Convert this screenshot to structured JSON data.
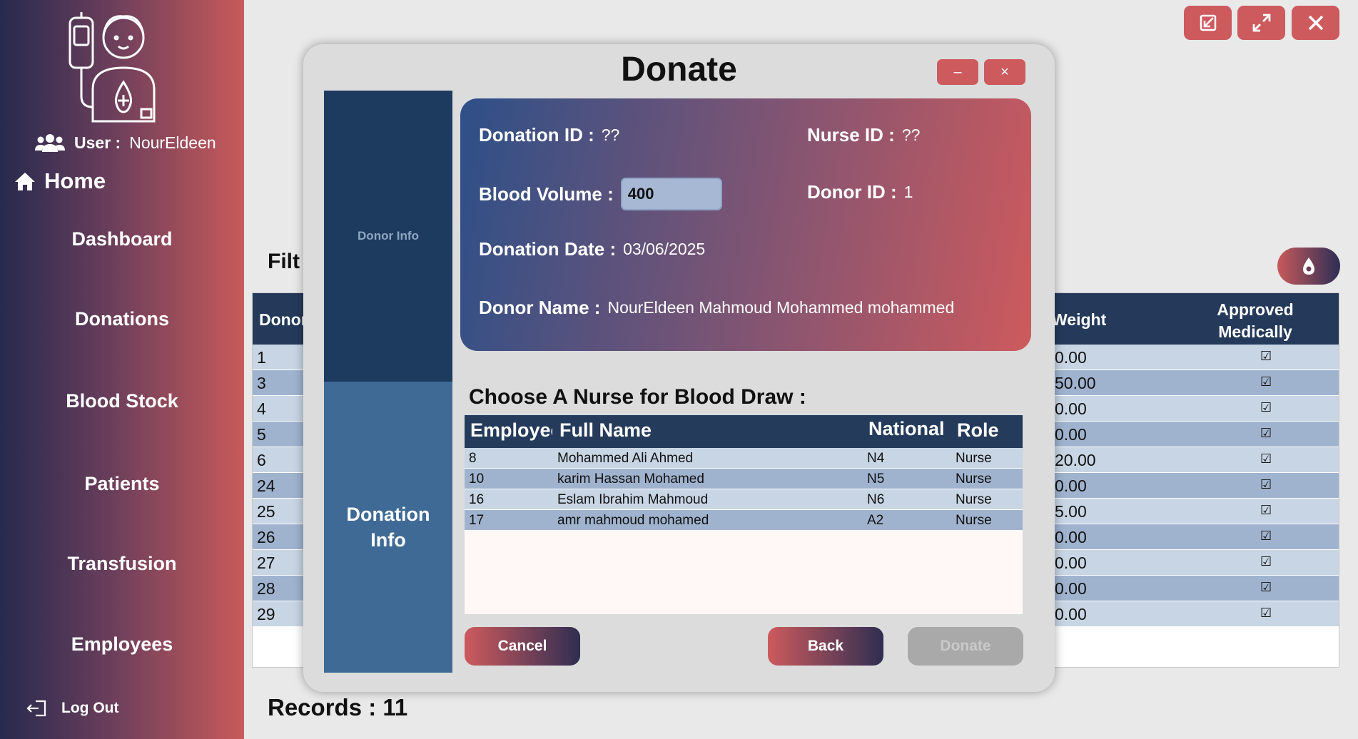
{
  "sidebar": {
    "user_label": "User :",
    "user_name": "NourEldeen",
    "home_label": "Home",
    "nav": [
      "Dashboard",
      "Donations",
      "Blood Stock",
      "Patients",
      "Transfusion",
      "Employees"
    ],
    "logout_label": "Log Out"
  },
  "colors": {
    "accent_red": "#cd5a5d",
    "navy": "#253a5a",
    "sidebar_dark": "#262a4e"
  },
  "background": {
    "filter_label": "Filt",
    "table": {
      "headers": [
        "Donor",
        "Weight",
        "Approved Medically"
      ],
      "rows": [
        {
          "id": "1",
          "weight": "0.00",
          "approved": "☑"
        },
        {
          "id": "3",
          "weight": "50.00",
          "approved": "☑"
        },
        {
          "id": "4",
          "weight": "0.00",
          "approved": "☑"
        },
        {
          "id": "5",
          "weight": "0.00",
          "approved": "☑"
        },
        {
          "id": "6",
          "weight": "20.00",
          "approved": "☑"
        },
        {
          "id": "24",
          "weight": "0.00",
          "approved": "☑"
        },
        {
          "id": "25",
          "weight": "5.00",
          "approved": "☑"
        },
        {
          "id": "26",
          "weight": "0.00",
          "approved": "☑"
        },
        {
          "id": "27",
          "weight": "0.00",
          "approved": "☑"
        },
        {
          "id": "28",
          "weight": "0.00",
          "approved": "☑"
        },
        {
          "id": "29",
          "weight": "0.00",
          "approved": "☑"
        }
      ]
    },
    "records_label": "Records : 11"
  },
  "modal": {
    "title": "Donate",
    "minimize_label": "–",
    "close_label": "×",
    "tabs": {
      "donor": "Donor Info",
      "donation": "Donation Info"
    },
    "fields": {
      "donation_id_label": "Donation ID :",
      "donation_id_value": "??",
      "nurse_id_label": "Nurse ID :",
      "nurse_id_value": "??",
      "blood_volume_label": "Blood Volume :",
      "blood_volume_value": "400",
      "donor_id_label": "Donor ID :",
      "donor_id_value": "1",
      "donation_date_label": "Donation Date :",
      "donation_date_value": "03/06/2025",
      "donor_name_label": "Donor Name :",
      "donor_name_value": "NourEldeen Mahmoud Mohammed mohammed"
    },
    "choose_label": "Choose A Nurse for Blood Draw  :",
    "nurse_table": {
      "headers": [
        "Employee",
        "Full Name",
        "National",
        "Role"
      ],
      "rows": [
        {
          "id": "8",
          "name": "Mohammed Ali Ahmed",
          "national": "N4",
          "role": "Nurse"
        },
        {
          "id": "10",
          "name": "karim Hassan Mohamed",
          "national": "N5",
          "role": "Nurse"
        },
        {
          "id": "16",
          "name": "Eslam Ibrahim Mahmoud",
          "national": "N6",
          "role": "Nurse"
        },
        {
          "id": "17",
          "name": "amr mahmoud  mohamed",
          "national": "A2",
          "role": "Nurse"
        }
      ]
    },
    "buttons": {
      "cancel": "Cancel",
      "back": "Back",
      "donate": "Donate"
    }
  }
}
